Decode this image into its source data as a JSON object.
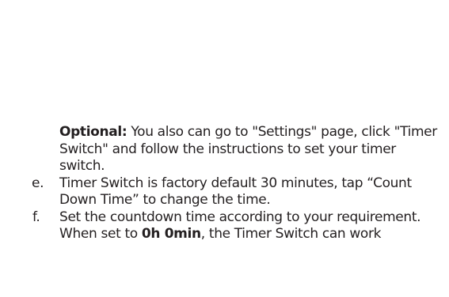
{
  "optional": {
    "label": "Optional:",
    "text": " You also can go to \"Settings\" page, click \"Timer Switch\" and follow the instructions to set your timer switch."
  },
  "steps": [
    {
      "marker": "e.",
      "text": "Timer Switch is factory default 30 minutes, tap “Count Down Time” to change the time."
    },
    {
      "marker": "f.",
      "text": "Set the countdown time according to your requirement.",
      "note_prefix": "When set to ",
      "note_bold": "0h 0min",
      "note_suffix": ", the Timer Switch can work"
    }
  ]
}
